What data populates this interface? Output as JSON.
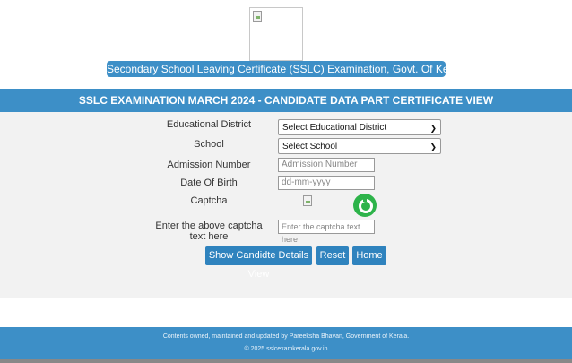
{
  "header": {
    "title_banner": "Secondary School Leaving Certificate (SSLC) Examination, Govt. Of Kerala"
  },
  "section_bar": "SSLC EXAMINATION MARCH 2024 - CANDIDATE DATA PART CERTIFICATE VIEW",
  "form": {
    "educational_district_label": "Educational District",
    "educational_district_value": "Select Educational District",
    "school_label": "School",
    "school_value": "Select School",
    "admission_label": "Admission Number",
    "admission_placeholder": "Admission Number",
    "dob_label": "Date Of Birth",
    "dob_placeholder": "dd-mm-yyyy",
    "captcha_label": "Captcha",
    "captcha_text_label": "Enter the above captcha text here",
    "captcha_placeholder": "Enter the captcha text here"
  },
  "buttons": {
    "show": "Show Candidte Details View",
    "reset": "Reset",
    "home": "Home"
  },
  "footer": {
    "line1": "Contents owned, maintained and updated by Pareeksha Bhavan, Government of Kerala.",
    "line2": "© 2025 sslcexamkerala.gov.in"
  },
  "colors": {
    "accent": "#3d8fc7",
    "refresh": "#2db34a"
  }
}
